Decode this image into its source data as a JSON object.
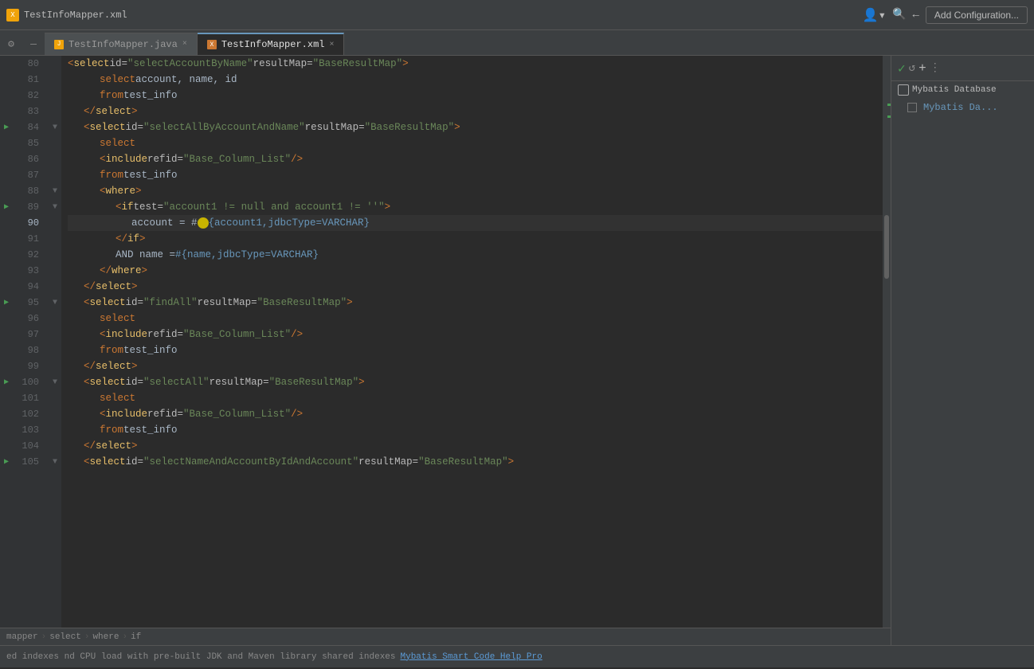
{
  "titlebar": {
    "filename": "TestInfoMapper.xml",
    "icon_label": "X",
    "add_config_label": "Add Configuration...",
    "user_icon": "👤",
    "search_icon": "🔍"
  },
  "tabs": [
    {
      "id": "java",
      "label": "TestInfoMapper.java",
      "type": "java",
      "active": false,
      "closeable": true
    },
    {
      "id": "xml",
      "label": "TestInfoMapper.xml",
      "type": "xml",
      "active": true,
      "closeable": true
    }
  ],
  "breadcrumb": {
    "items": [
      "mapper",
      "select",
      "where",
      "if"
    ]
  },
  "right_panel": {
    "title": "Mybatis Database",
    "items": [
      "Mybatis Da..."
    ]
  },
  "notification": {
    "text": "ed indexes",
    "detail": "nd CPU load with pre-built JDK and Maven library shared indexes",
    "link_label": "Mybatis Smart Code Help Pro"
  },
  "code_lines": [
    {
      "num": 80,
      "indent": 2,
      "content": "<select id=\"selectAccountByName\" resultMap=\"BaseResultMap\">",
      "type": "truncated"
    },
    {
      "num": 81,
      "indent": 3,
      "content": "select account, name, id",
      "type": "sql"
    },
    {
      "num": 82,
      "indent": 3,
      "content": "from test_info",
      "type": "sql"
    },
    {
      "num": 83,
      "indent": 2,
      "content": "</select>",
      "type": "xml-close"
    },
    {
      "num": 84,
      "indent": 2,
      "content": "<select id=\"selectAllByAccountAndName\" resultMap=\"BaseResultMap\">",
      "type": "xml-open",
      "bookmark": true
    },
    {
      "num": 85,
      "indent": 3,
      "content": "select",
      "type": "sql"
    },
    {
      "num": 86,
      "indent": 3,
      "content": "<include refid=\"Base_Column_List\"/>",
      "type": "xml"
    },
    {
      "num": 87,
      "indent": 3,
      "content": "from test_info",
      "type": "sql"
    },
    {
      "num": 88,
      "indent": 3,
      "content": "<where>",
      "type": "xml-open"
    },
    {
      "num": 89,
      "indent": 4,
      "content": "<if test=\"account1 != null and account1 != ''\">",
      "type": "xml-open",
      "bookmark": true
    },
    {
      "num": 90,
      "indent": 5,
      "content": "account = #{account1,jdbcType=VARCHAR}",
      "type": "sql-expr",
      "active": true,
      "cursor": true
    },
    {
      "num": 91,
      "indent": 4,
      "content": "</if>",
      "type": "xml-close"
    },
    {
      "num": 92,
      "indent": 4,
      "content": "AND name = #{name,jdbcType=VARCHAR}",
      "type": "sql-expr"
    },
    {
      "num": 93,
      "indent": 3,
      "content": "</where>",
      "type": "xml-close"
    },
    {
      "num": 94,
      "indent": 2,
      "content": "</select>",
      "type": "xml-close"
    },
    {
      "num": 95,
      "indent": 2,
      "content": "<select id=\"findAll\" resultMap=\"BaseResultMap\">",
      "type": "xml-open",
      "bookmark": true
    },
    {
      "num": 96,
      "indent": 3,
      "content": "select",
      "type": "sql"
    },
    {
      "num": 97,
      "indent": 3,
      "content": "<include refid=\"Base_Column_List\"/>",
      "type": "xml"
    },
    {
      "num": 98,
      "indent": 3,
      "content": "from test_info",
      "type": "sql"
    },
    {
      "num": 99,
      "indent": 2,
      "content": "</select>",
      "type": "xml-close"
    },
    {
      "num": 100,
      "indent": 2,
      "content": "<select id=\"selectAll\" resultMap=\"BaseResultMap\">",
      "type": "xml-open",
      "bookmark": true
    },
    {
      "num": 101,
      "indent": 3,
      "content": "select",
      "type": "sql"
    },
    {
      "num": 102,
      "indent": 3,
      "content": "<include refid=\"Base_Column_List\"/>",
      "type": "xml"
    },
    {
      "num": 103,
      "indent": 3,
      "content": "from test_info",
      "type": "sql"
    },
    {
      "num": 104,
      "indent": 2,
      "content": "</select>",
      "type": "xml-close"
    },
    {
      "num": 105,
      "indent": 2,
      "content": "<select id=\"selectNameAndAccountByIdAndAccount\" resultMap=\"BaseResultMap\">",
      "type": "xml-open",
      "bookmark": true,
      "truncated": true
    }
  ]
}
